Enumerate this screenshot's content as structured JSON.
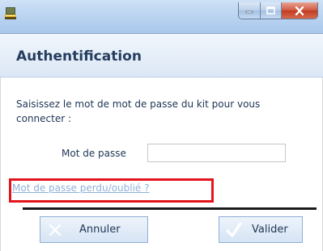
{
  "window": {
    "icon": "usb-key-icon",
    "controls": [
      "minimize-icon",
      "maximize-icon",
      "close-icon"
    ]
  },
  "header": {
    "title": "Authentification"
  },
  "body": {
    "instructions": "Saisissez le mot de mot de passe du kit pour vous connecter :",
    "password_label": "Mot de passe",
    "password_value": "",
    "forgot_link": "Mot de passe perdu/oublié ?"
  },
  "buttons": {
    "cancel_label": "Annuler",
    "cancel_icon": "x-icon",
    "ok_label": "Valider",
    "ok_icon": "checkmark-icon"
  },
  "colors": {
    "highlight_box": "#e3141c",
    "link": "#8fb0dc",
    "text": "#1e3554"
  }
}
